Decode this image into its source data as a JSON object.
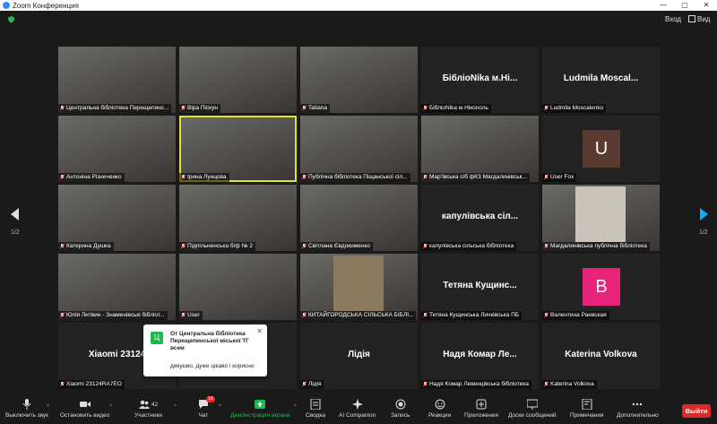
{
  "window": {
    "title": "Zoom Конференция"
  },
  "topbar": {
    "signin_label": "Вход",
    "view_label": "Вид"
  },
  "pagination": {
    "left": "1/2",
    "right": "1/2"
  },
  "tiles": [
    {
      "name": "Центральна бібліотека Перещепинс..."
    },
    {
      "name": "Віра Піскун"
    },
    {
      "name": "Tatiana"
    },
    {
      "name": "БібліоNika м.Нікополь",
      "big": "БібліоNika м.Ні..."
    },
    {
      "name": "Ludmila Moscalenko",
      "big": "Ludmila  Moscal..."
    },
    {
      "name": "Антоніна Різниченко"
    },
    {
      "name": "Ірина Лунцова"
    },
    {
      "name": "Публічна бібліотека Піщанської сіл..."
    },
    {
      "name": "Мар'ївська с/б фКЗ Магдалинівськ..."
    },
    {
      "name": "User Fox",
      "avatar": "U",
      "avatar_color": "#5b3a32"
    },
    {
      "name": "Катерина Душка"
    },
    {
      "name": "Підпільненська б/ф № 2"
    },
    {
      "name": "Світлана Євдокименко"
    },
    {
      "name": "капулівська сільська бібліотека",
      "big": "капулівська сіл..."
    },
    {
      "name": "Магдалинівська публічна бібліотека"
    },
    {
      "name": "Юлія Литвин - Знаменівські бібліот..."
    },
    {
      "name": "User"
    },
    {
      "name": "КИТАЙГОРОДСЬКА СІЛЬСЬКА БІБЛІ..."
    },
    {
      "name": "Тетяна Кущинська Личківська ПБ",
      "big": "Тетяна  Кущинс..."
    },
    {
      "name": "Валентина Раевская",
      "avatar": "B",
      "avatar_color": "#e8237a"
    },
    {
      "name": "Xiaomi 23124RA7EO",
      "big": "Xiaomi  23124"
    },
    {
      "name": "",
      "big": "...а"
    },
    {
      "name": "Лідія",
      "big": "Лідія"
    },
    {
      "name": "Надя Комар Левенцівська бібліотека",
      "big": "Надя  Комар  Ле..."
    },
    {
      "name": "Katerina Volkova",
      "big": "Katerina  Volkova"
    }
  ],
  "notification": {
    "chip": "Ц",
    "from": "От Центральна бібліотека Перещепинської міської ТГ всем",
    "message": "дякуємо, дуже цікаво і корисно"
  },
  "toolbar": {
    "mute": "Выключить звук",
    "video": "Остановить видео",
    "participants": "Участники",
    "participants_count": "42",
    "chat": "Чат",
    "chat_badge": "16",
    "share": "Демонстрация экрана",
    "summary": "Сводка",
    "ai": "AI Companion",
    "record": "Запись",
    "reactions": "Реакции",
    "apps": "Приложения",
    "whiteboards": "Доски сообщений",
    "notes": "Примечания",
    "more": "Дополнительно",
    "leave": "Выйти"
  },
  "colors": {
    "share_green": "#1fba4b",
    "leave_red": "#e02828",
    "active_speaker": "#e2e22a"
  }
}
